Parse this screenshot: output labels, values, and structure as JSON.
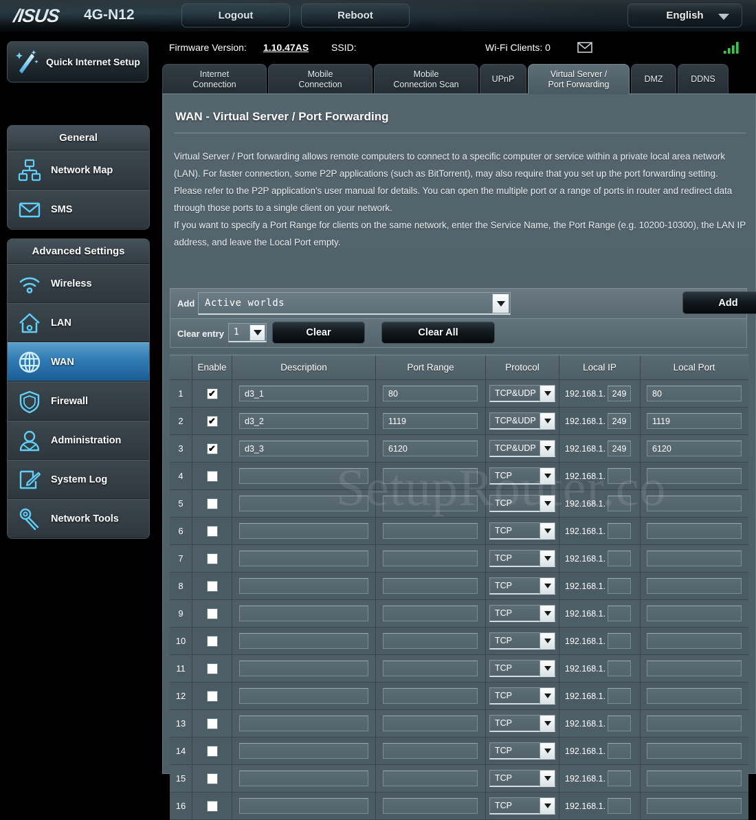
{
  "topbar": {
    "brand": "/ISUS",
    "model": "4G-N12",
    "logout_label": "Logout",
    "reboot_label": "Reboot",
    "language": "English",
    "caret_icon": "chevron-down-icon"
  },
  "quick_setup": {
    "label": "Quick Internet Setup",
    "icon": "magic-wand-icon"
  },
  "sidebar": {
    "groups": [
      {
        "title": "General",
        "items": [
          {
            "label": "Network Map",
            "icon": "network-map-icon",
            "active": false
          },
          {
            "label": "SMS",
            "icon": "envelope-icon",
            "active": false
          }
        ]
      },
      {
        "title": "Advanced Settings",
        "items": [
          {
            "label": "Wireless",
            "icon": "wifi-icon",
            "active": false
          },
          {
            "label": "LAN",
            "icon": "home-icon",
            "active": false
          },
          {
            "label": "WAN",
            "icon": "globe-icon",
            "active": true
          },
          {
            "label": "Firewall",
            "icon": "shield-icon",
            "active": false
          },
          {
            "label": "Administration",
            "icon": "user-icon",
            "active": false
          },
          {
            "label": "System Log",
            "icon": "note-pencil-icon",
            "active": false
          },
          {
            "label": "Network Tools",
            "icon": "wrench-icon",
            "active": false
          }
        ]
      }
    ]
  },
  "status": {
    "firmware_label": "Firmware Version:",
    "firmware_value": "1.10.47AS",
    "ssid_label": "SSID:",
    "ssid_value": "",
    "wifi_clients": "Wi-Fi Clients: 0",
    "mail_icon": "envelope-icon",
    "signal_icon": "signal-bars-icon",
    "signal_color": "#35cc44"
  },
  "tabs": [
    {
      "label": "Internet\nConnection",
      "active": false
    },
    {
      "label": "Mobile\nConnection",
      "active": false
    },
    {
      "label": "Mobile\nConnection Scan",
      "active": false
    },
    {
      "label": "UPnP",
      "active": false
    },
    {
      "label": "Virtual Server /\nPort Forwarding",
      "active": true
    },
    {
      "label": "DMZ",
      "active": false
    },
    {
      "label": "DDNS",
      "active": false
    }
  ],
  "page": {
    "title": "WAN - Virtual Server / Port Forwarding",
    "description": "Virtual Server / Port forwarding allows remote computers to connect to a specific computer or service within a private local area network (LAN). For faster connection, some P2P applications (such as BitTorrent), may also require that you set up the port forwarding setting. Please refer to the P2P application's user manual for details. You can open the multiple port or a range of ports in router and redirect data through those ports to a single client on your network.\nIf you want to specify a Port Range for clients on the same network, enter the Service Name, the Port Range (e.g. 10200-10300), the LAN IP address, and leave the Local Port empty."
  },
  "add_bar": {
    "add_label": "Add",
    "famous_server_value": "Active worlds",
    "add_button": "Add"
  },
  "clear_bar": {
    "clear_entry_label": "Clear entry",
    "entry_value": "1",
    "clear_button": "Clear",
    "clear_all_button": "Clear All"
  },
  "table": {
    "headers": [
      "",
      "Enable",
      "Description",
      "Port Range",
      "Protocol",
      "Local IP",
      "Local Port"
    ],
    "ip_prefix": "192.168.1.",
    "rows": [
      {
        "num": "1",
        "enabled": true,
        "description": "d3_1",
        "port_range": "80",
        "protocol": "TCP&UDP",
        "local_ip_octet": "249",
        "local_port": "80"
      },
      {
        "num": "2",
        "enabled": true,
        "description": "d3_2",
        "port_range": "1119",
        "protocol": "TCP&UDP",
        "local_ip_octet": "249",
        "local_port": "1119"
      },
      {
        "num": "3",
        "enabled": true,
        "description": "d3_3",
        "port_range": "6120",
        "protocol": "TCP&UDP",
        "local_ip_octet": "249",
        "local_port": "6120"
      },
      {
        "num": "4",
        "enabled": false,
        "description": "",
        "port_range": "",
        "protocol": "TCP",
        "local_ip_octet": "",
        "local_port": ""
      },
      {
        "num": "5",
        "enabled": false,
        "description": "",
        "port_range": "",
        "protocol": "TCP",
        "local_ip_octet": "",
        "local_port": ""
      },
      {
        "num": "6",
        "enabled": false,
        "description": "",
        "port_range": "",
        "protocol": "TCP",
        "local_ip_octet": "",
        "local_port": ""
      },
      {
        "num": "7",
        "enabled": false,
        "description": "",
        "port_range": "",
        "protocol": "TCP",
        "local_ip_octet": "",
        "local_port": ""
      },
      {
        "num": "8",
        "enabled": false,
        "description": "",
        "port_range": "",
        "protocol": "TCP",
        "local_ip_octet": "",
        "local_port": ""
      },
      {
        "num": "9",
        "enabled": false,
        "description": "",
        "port_range": "",
        "protocol": "TCP",
        "local_ip_octet": "",
        "local_port": ""
      },
      {
        "num": "10",
        "enabled": false,
        "description": "",
        "port_range": "",
        "protocol": "TCP",
        "local_ip_octet": "",
        "local_port": ""
      },
      {
        "num": "11",
        "enabled": false,
        "description": "",
        "port_range": "",
        "protocol": "TCP",
        "local_ip_octet": "",
        "local_port": ""
      },
      {
        "num": "12",
        "enabled": false,
        "description": "",
        "port_range": "",
        "protocol": "TCP",
        "local_ip_octet": "",
        "local_port": ""
      },
      {
        "num": "13",
        "enabled": false,
        "description": "",
        "port_range": "",
        "protocol": "TCP",
        "local_ip_octet": "",
        "local_port": ""
      },
      {
        "num": "14",
        "enabled": false,
        "description": "",
        "port_range": "",
        "protocol": "TCP",
        "local_ip_octet": "",
        "local_port": ""
      },
      {
        "num": "15",
        "enabled": false,
        "description": "",
        "port_range": "",
        "protocol": "TCP",
        "local_ip_octet": "",
        "local_port": ""
      },
      {
        "num": "16",
        "enabled": false,
        "description": "",
        "port_range": "",
        "protocol": "TCP",
        "local_ip_octet": "",
        "local_port": ""
      }
    ]
  },
  "watermark": {
    "text": "SetupRouter.co"
  }
}
